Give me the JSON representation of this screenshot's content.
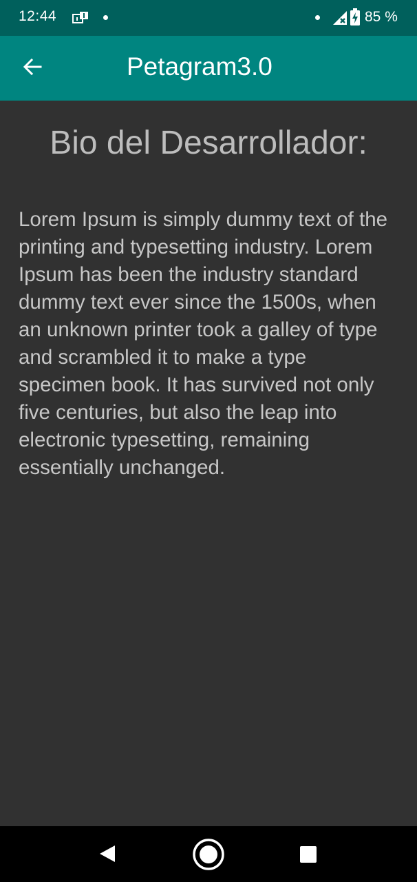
{
  "status_bar": {
    "time": "12:44",
    "battery_percent": "85 %",
    "icons": [
      "notification-icon",
      "dot-icon",
      "dot-icon",
      "signal-icon",
      "battery-charging-icon"
    ]
  },
  "app_bar": {
    "title": "Petagram3.0",
    "back_icon": "arrow-back-icon",
    "background_color": "#008580"
  },
  "content": {
    "heading": "Bio del Desarrollador:",
    "body": "Lorem Ipsum is simply dummy text of the printing and typesetting industry. Lorem Ipsum has been the industry standard dummy text ever since the 1500s, when an unknown printer took a galley of type and scrambled it to make a type specimen book. It has survived not only five centuries, but also the leap into electronic typesetting, remaining essentially unchanged."
  },
  "nav_bar": {
    "buttons": [
      "nav-back-icon",
      "nav-home-icon",
      "nav-recents-icon"
    ]
  },
  "colors": {
    "status_bar": "#00605c",
    "background": "#313131",
    "text": "#c7c7c7"
  }
}
